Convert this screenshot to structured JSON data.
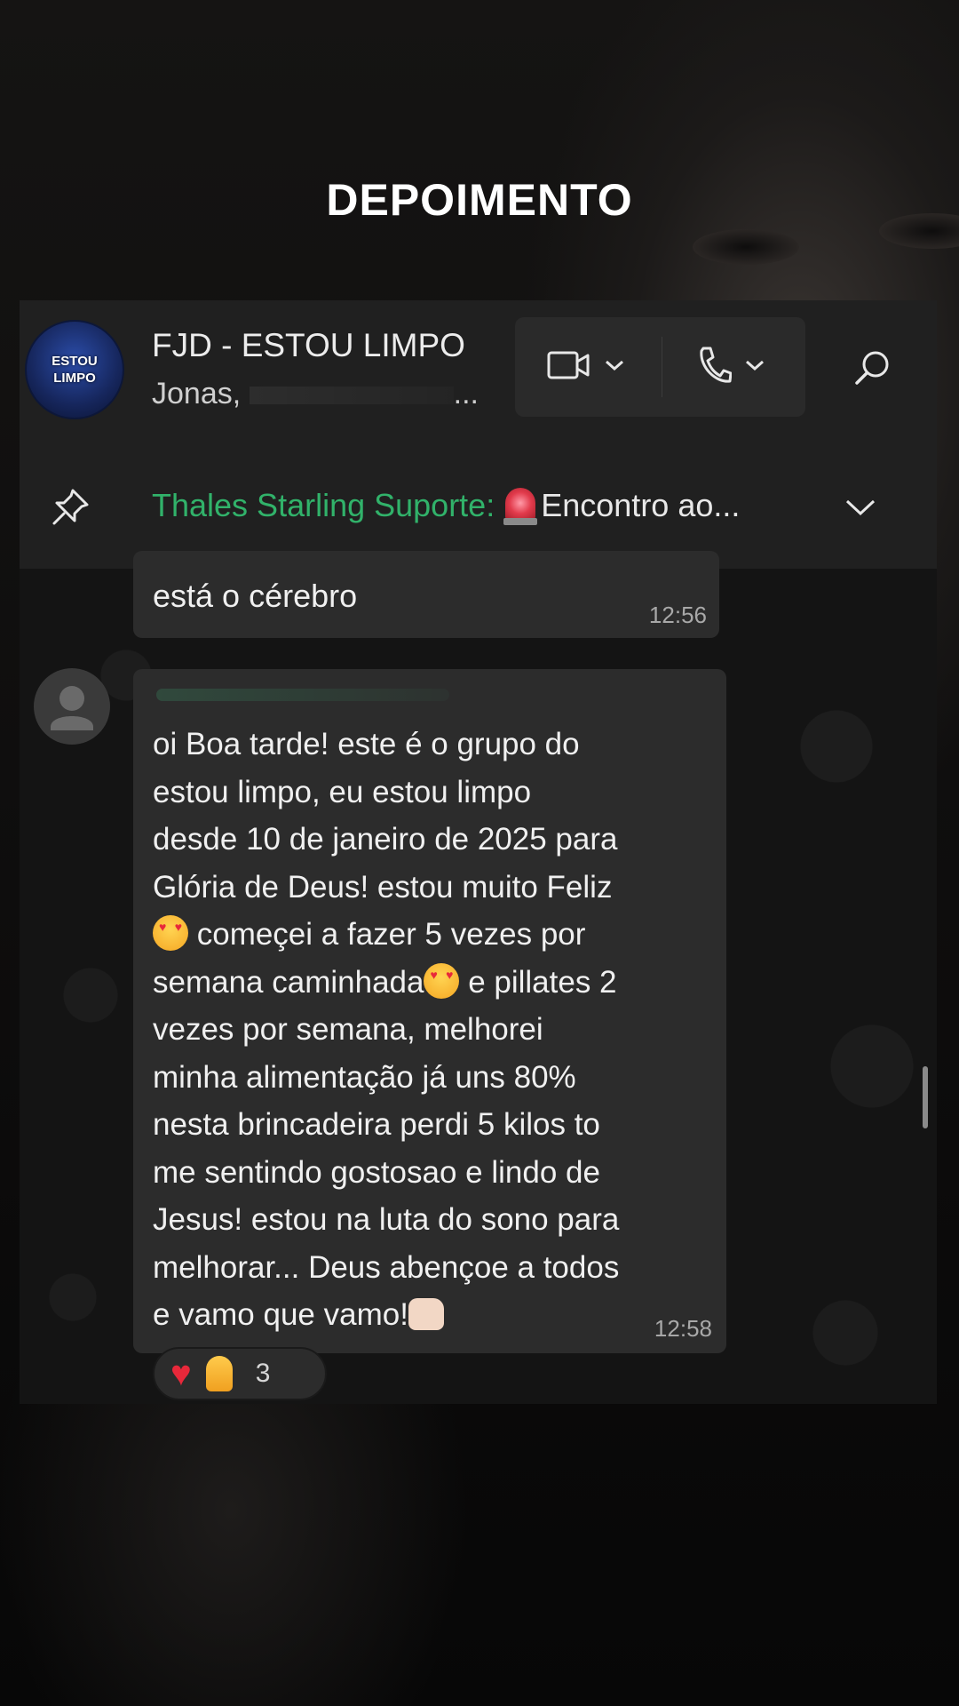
{
  "page_title": "DEPOIMENTO",
  "chat": {
    "group_name": "FJD - ESTOU LIMPO",
    "members_preview": "Jonas,",
    "members_ellipsis": "...",
    "avatar_text_line1": "ESTOU",
    "avatar_text_line2": "LIMPO",
    "icons": [
      "video-call-icon",
      "phone-icon",
      "chevron-down-icon",
      "search-icon",
      "pin-icon"
    ]
  },
  "pinned": {
    "author": "Thales Starling Suporte:",
    "text": "Encontro ao..."
  },
  "messages": [
    {
      "text": "está o cérebro",
      "time": "12:56"
    },
    {
      "text_part1": "oi Boa tarde! este é o grupo do\nestou limpo, eu estou limpo\ndesde 10 de janeiro de 2025 para\nGlória de Deus! estou muito Feliz\n",
      "text_part2": " começei a fazer 5 vezes por\nsemana caminhada",
      "text_part3": " e pillates 2\nvezes por semana, melhorei\nminha alimentação já uns 80%\nnesta brincadeira perdi 5 kilos to\nme sentindo gostosao e lindo de\nJesus! estou na luta do sono para\nmelhorar... Deus abençoe a todos\ne vamo que vamo!",
      "time": "12:58",
      "reaction_count": "3"
    }
  ]
}
